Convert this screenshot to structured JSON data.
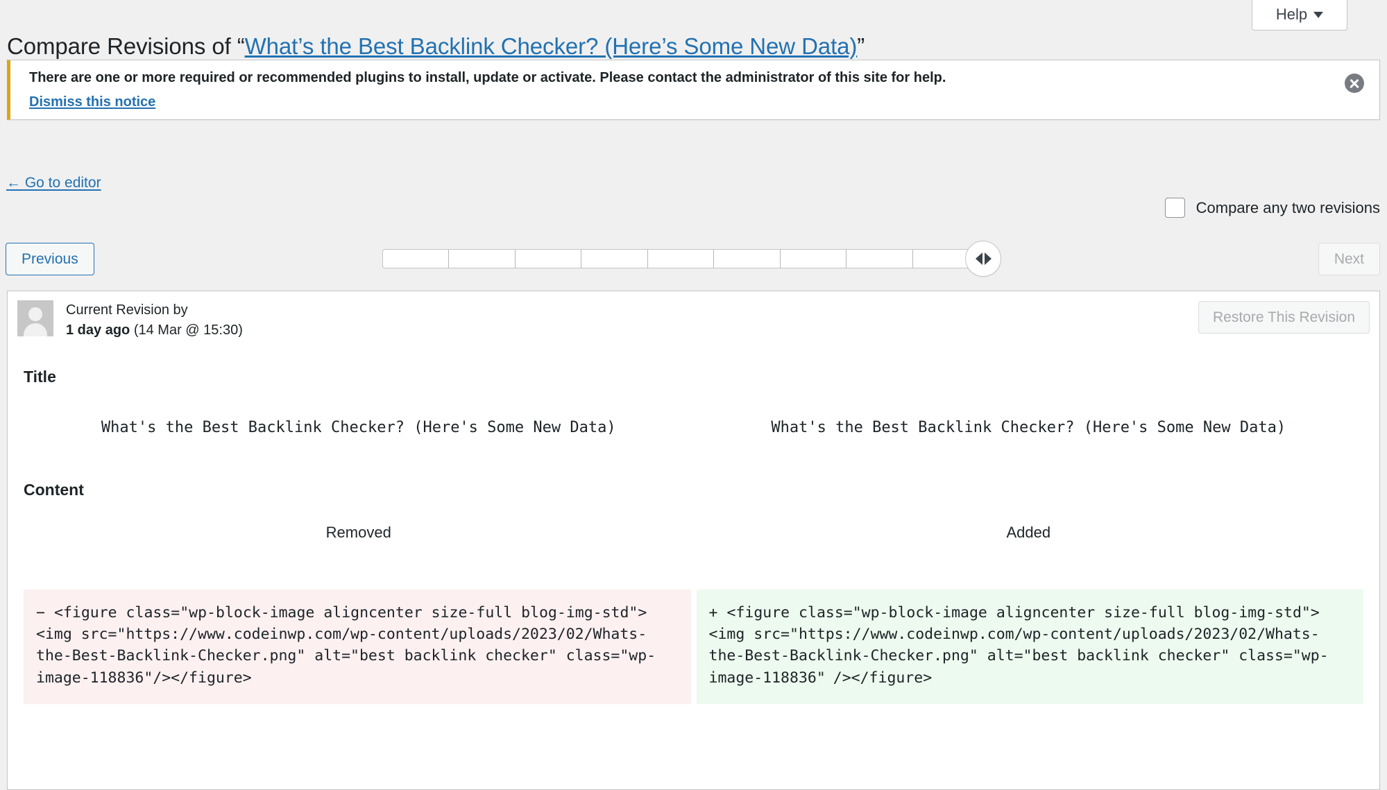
{
  "help": {
    "label": "Help",
    "caret_icon": "chevron-down-icon"
  },
  "header": {
    "prefix": "Compare Revisions of “",
    "post_title_link": "What’s the Best Backlink Checker? (Here’s Some New Data)",
    "suffix": "”"
  },
  "notice": {
    "message": "There are one or more required or recommended plugins to install, update or activate. Please contact the administrator of this site for help.",
    "dismiss_link": "Dismiss this notice",
    "close_icon": "close-circle-icon",
    "accent_color": "#dba617"
  },
  "back_link": {
    "label": "← Go to editor"
  },
  "compare_toggle": {
    "label": "Compare any two revisions",
    "checked": false
  },
  "controls": {
    "previous_label": "Previous",
    "next_label": "Next",
    "next_disabled": true,
    "slider": {
      "ticks": 9,
      "handle_position": "right",
      "handle_icon": "left-right-arrows-icon"
    }
  },
  "revision_meta": {
    "avatar_icon": "user-avatar",
    "author_line": "Current Revision by",
    "time_relative": "1 day ago",
    "time_absolute": "(14 Mar @ 15:30)",
    "restore_label": "Restore This Revision",
    "restore_disabled": true
  },
  "diff": {
    "title_section_heading": "Title",
    "content_section_heading": "Content",
    "title_removed": "What's the Best Backlink Checker? (Here's Some New Data)",
    "title_added": "What's the Best Backlink Checker? (Here's Some New Data)",
    "col_removed_label": "Removed",
    "col_added_label": "Added",
    "removed_marker": "−",
    "added_marker": "+",
    "removed_text": "<figure class=\"wp-block-image aligncenter size-full blog-img-std\"><img src=\"https://www.codeinwp.com/wp-content/uploads/2023/02/Whats-the-Best-Backlink-Checker.png\" alt=\"best backlink checker\" class=\"wp-image-118836\"/></figure>",
    "added_text_before": "<figure class=\"wp-block-image aligncenter size-full blog-img-std\"><img src=\"https://www.codeinwp.com/wp-content/uploads/2023/02/Whats-the-Best-Backlink-Checker.png\" alt=\"best backlink checker\" class=\"wp-image-118836\"",
    "added_highlight": " ",
    "added_text_after": "/></figure>",
    "removed_bg": "#fcf0f1",
    "added_bg": "#edfaef",
    "added_highlight_color": "#4ed885"
  }
}
